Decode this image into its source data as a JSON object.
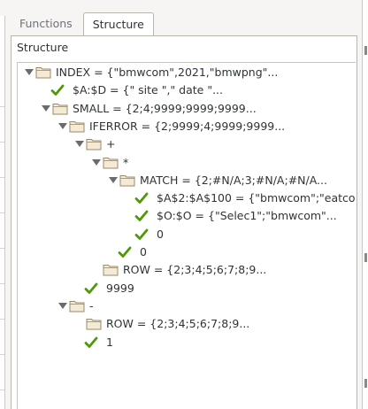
{
  "tabs": [
    {
      "label": "Functions",
      "active": false
    },
    {
      "label": "Structure",
      "active": true
    }
  ],
  "panel": {
    "label": "Structure"
  },
  "colors": {
    "check_green": "#4e9a06",
    "folder_fill": "#f4ead6",
    "folder_stroke": "#9a8a6a"
  },
  "tree": [
    {
      "kind": "folder",
      "depth": 0,
      "text": "INDEX = {\"bmwcom\",2021,\"bmwpng\"..."
    },
    {
      "kind": "value",
      "depth": 1,
      "text": "$A:$D = {\" site \",\" date \"..."
    },
    {
      "kind": "folder",
      "depth": 1,
      "text": "SMALL = {2;4;9999;9999;9999..."
    },
    {
      "kind": "folder",
      "depth": 2,
      "text": "IFERROR = {2;9999;4;9999;9999..."
    },
    {
      "kind": "folder",
      "depth": 3,
      "text": "+"
    },
    {
      "kind": "folder",
      "depth": 4,
      "text": "*"
    },
    {
      "kind": "folder",
      "depth": 5,
      "text": "MATCH = {2;#N/A;3;#N/A;#N/A..."
    },
    {
      "kind": "value",
      "depth": 6,
      "text": "$A$2:$A$100 = {\"bmwcom\";\"eatcom\""
    },
    {
      "kind": "value",
      "depth": 6,
      "text": "$O:$O = {\"Selec1\";\"bmwcom\"..."
    },
    {
      "kind": "value",
      "depth": 6,
      "text": "0"
    },
    {
      "kind": "value",
      "depth": 5,
      "text": "0"
    },
    {
      "kind": "leaf-folder",
      "depth": 4,
      "text": "ROW = {2;3;4;5;6;7;8;9..."
    },
    {
      "kind": "value",
      "depth": 3,
      "text": "9999"
    },
    {
      "kind": "folder",
      "depth": 2,
      "text": "-"
    },
    {
      "kind": "leaf-folder",
      "depth": 3,
      "text": "ROW = {2;3;4;5;6;7;8;9..."
    },
    {
      "kind": "value",
      "depth": 3,
      "text": "1"
    }
  ]
}
